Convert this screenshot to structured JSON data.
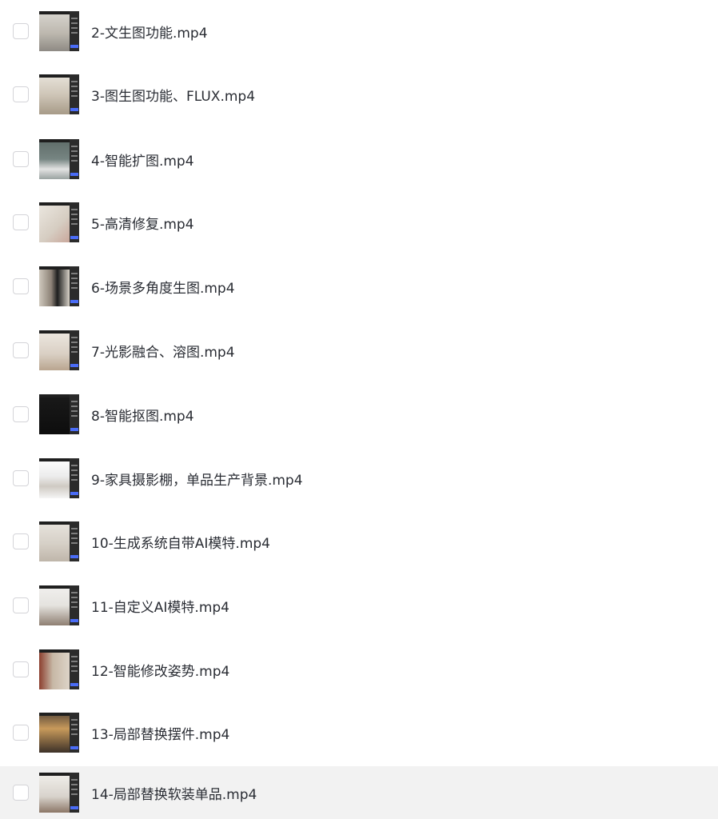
{
  "files": [
    {
      "name": "2-文生图功能.mp4",
      "thumb": {
        "bg": "#4a4a4a",
        "scene": "linear-gradient(180deg,#d9d6d0 0%,#bdb8af 55%,#8e8a84 100%)"
      }
    },
    {
      "name": "3-图生图功能、FLUX.mp4",
      "thumb": {
        "bg": "#c9c2b6",
        "scene": "linear-gradient(180deg,#e8e3da 0%,#cfc6b8 50%,#a79b88 100%)"
      }
    },
    {
      "name": "4-智能扩图.mp4",
      "thumb": {
        "bg": "#3f4a4a",
        "scene": "linear-gradient(180deg,#5d6b68 0%,#768582 50%,#e3e3e3 75%,#9aa3a1 100%)"
      }
    },
    {
      "name": "5-高清修复.mp4",
      "thumb": {
        "bg": "#3a3a3a",
        "scene": "linear-gradient(135deg,#ece8e1 0%,#d6cdc2 60%,#c9a79b 100%)"
      }
    },
    {
      "name": "6-场景多角度生图.mp4",
      "thumb": {
        "bg": "#2f2f2f",
        "scene": "linear-gradient(90deg,#cfc8bd 0%,#8c8176 40%,#1e1e1e 60%,#d8d2c8 100%)"
      }
    },
    {
      "name": "7-光影融合、溶图.mp4",
      "thumb": {
        "bg": "#353535",
        "scene": "linear-gradient(180deg,#eee9e2 0%,#d9cfc3 60%,#b9a58f 100%)"
      }
    },
    {
      "name": "8-智能抠图.mp4",
      "thumb": {
        "bg": "#121212",
        "scene": "linear-gradient(180deg,#1a1a1a 0%,#0d0d0d 100%)"
      }
    },
    {
      "name": "9-家具摄影棚，单品生产背景.mp4",
      "thumb": {
        "bg": "#f3f3f3",
        "scene": "linear-gradient(180deg,#ffffff 0%,#ececec 45%,#cfcac3 70%,#f5f5f5 100%)"
      }
    },
    {
      "name": "10-生成系统自带AI模特.mp4",
      "thumb": {
        "bg": "#3c3c3c",
        "scene": "linear-gradient(180deg,#e8e4de 0%,#d6d0c7 55%,#bfb6aa 100%)"
      }
    },
    {
      "name": "11-自定义AI模特.mp4",
      "thumb": {
        "bg": "#333333",
        "scene": "linear-gradient(180deg,#f1f0ee 0%,#e5e3df 50%,#8e7f72 100%)"
      }
    },
    {
      "name": "12-智能修改姿势.mp4",
      "thumb": {
        "bg": "#3a2e2a",
        "scene": "linear-gradient(90deg,#8c3f2e 0%,#c7b8a6 45%,#ddd4c8 100%)"
      }
    },
    {
      "name": "13-局部替换摆件.mp4",
      "thumb": {
        "bg": "#2a2520",
        "scene": "linear-gradient(180deg,#5b4a3a 0%,#c89a5b 40%,#3d3128 100%)"
      }
    },
    {
      "name": "14-局部替换软装单品.mp4",
      "thumb": {
        "bg": "#3a3a3a",
        "scene": "linear-gradient(180deg,#f2f0ec 0%,#d8d3cc 60%,#8c7767 100%)"
      },
      "hovered": true
    }
  ]
}
